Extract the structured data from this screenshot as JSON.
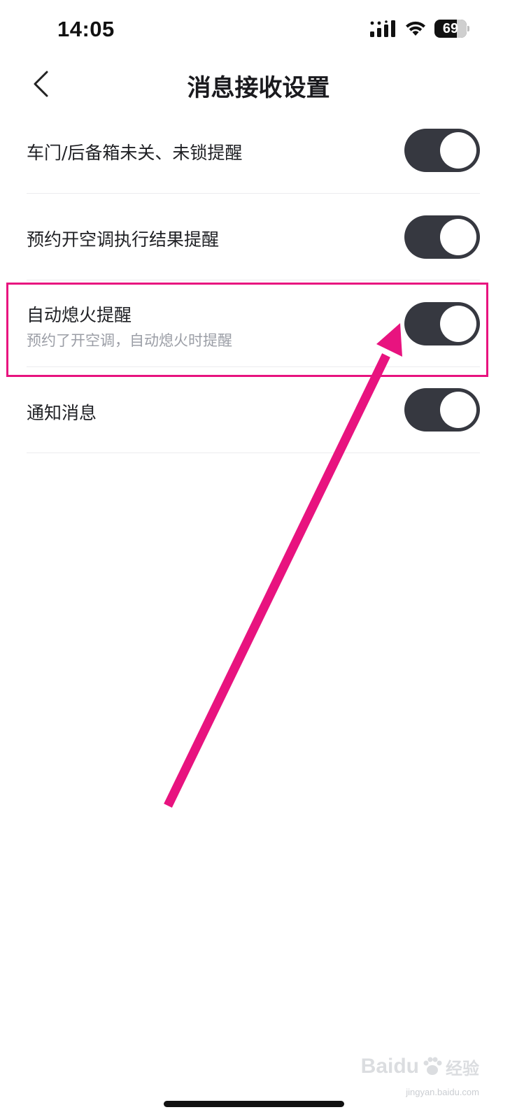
{
  "status_bar": {
    "time": "14:05",
    "battery_text": "69",
    "battery_level": 0.69,
    "icons": [
      "signal-icon",
      "wifi-icon",
      "battery-icon"
    ]
  },
  "nav": {
    "back_icon": "chevron-left-icon",
    "title": "消息接收设置"
  },
  "settings": [
    {
      "label": "车门/后备箱未关、未锁提醒",
      "sublabel": "",
      "enabled": true
    },
    {
      "label": "预约开空调执行结果提醒",
      "sublabel": "",
      "enabled": true
    },
    {
      "label": "自动熄火提醒",
      "sublabel": "预约了开空调，自动熄火时提醒",
      "enabled": true
    },
    {
      "label": "通知消息",
      "sublabel": "",
      "enabled": true
    }
  ],
  "annotation": {
    "color": "#e8137f",
    "highlight_target": "自动熄火提醒"
  },
  "watermark": {
    "brand": "Baidu",
    "cn": "经验",
    "url": "jingyan.baidu.com"
  },
  "colors": {
    "toggle_on": "#363840",
    "text_primary": "#1f2024",
    "text_secondary": "#9b9ea6",
    "divider": "#ececef"
  }
}
